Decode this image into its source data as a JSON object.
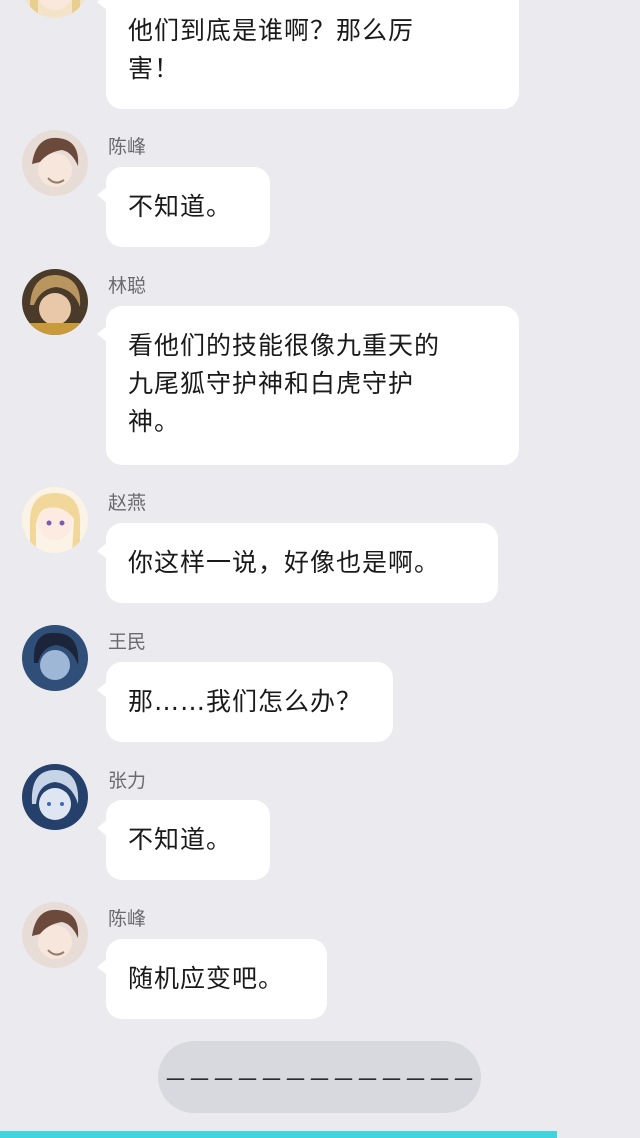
{
  "messages": [
    {
      "id": "m0",
      "sender": "",
      "text": "他们到底是谁啊？那么厉害！",
      "lines": [
        "他们到底是谁啊？那么厉",
        "害！"
      ],
      "avatar": "avatar-zhao-yan"
    },
    {
      "id": "m1",
      "sender": "陈峰",
      "text": "不知道。",
      "lines": [
        "不知道。"
      ],
      "avatar": "avatar-chen-feng"
    },
    {
      "id": "m2",
      "sender": "林聪",
      "text": "看他们的技能很像九重天的九尾狐守护神和白虎守护神。",
      "lines": [
        "看他们的技能很像九重天的",
        "九尾狐守护神和白虎守护",
        "神。"
      ],
      "avatar": "avatar-lin-cong"
    },
    {
      "id": "m3",
      "sender": "赵燕",
      "text": "你这样一说，好像也是啊。",
      "lines": [
        "你这样一说，好像也是啊。"
      ],
      "avatar": "avatar-zhao-yan"
    },
    {
      "id": "m4",
      "sender": "王民",
      "text": "那……我们怎么办？",
      "lines": [
        "那……我们怎么办？"
      ],
      "avatar": "avatar-wang-min"
    },
    {
      "id": "m5",
      "sender": "张力",
      "text": "不知道。",
      "lines": [
        "不知道。"
      ],
      "avatar": "avatar-zhang-li"
    },
    {
      "id": "m6",
      "sender": "陈峰",
      "text": "随机应变吧。",
      "lines": [
        "随机应变吧。"
      ],
      "avatar": "avatar-chen-feng"
    }
  ],
  "divider": {
    "text": "－－－－－－－－－－－－－"
  },
  "colors": {
    "background": "#ebebef",
    "bubble": "#ffffff",
    "divider_pill": "#d8d9de",
    "bottom_bar": "#3fd4de"
  }
}
